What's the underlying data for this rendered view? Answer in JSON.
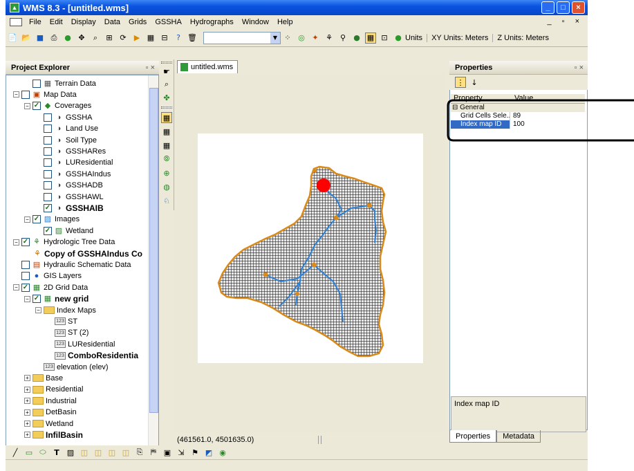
{
  "window": {
    "title": "WMS 8.3 - [untitled.wms]",
    "app_icon": "wms-app-icon",
    "controls": [
      "minimize",
      "maximize",
      "close"
    ]
  },
  "menu": {
    "items": [
      "File",
      "Edit",
      "Display",
      "Data",
      "Grids",
      "GSSHA",
      "Hydrographs",
      "Window",
      "Help"
    ],
    "mdi_controls": "_ &#x1F5D7; ×"
  },
  "toolbar": {
    "units_button": "Units",
    "xy_units": "XY Units: Meters",
    "z_units": "Z Units: Meters"
  },
  "explorer": {
    "title": "Project Explorer",
    "close": "×",
    "items": [
      {
        "label": "Terrain Data",
        "level": 1,
        "bold": false
      },
      {
        "label": "Map Data",
        "level": 0,
        "bold": false
      },
      {
        "label": "Coverages",
        "level": 1,
        "bold": false
      },
      {
        "label": "GSSHA",
        "level": 2,
        "bold": false
      },
      {
        "label": "Land Use",
        "level": 2,
        "bold": false
      },
      {
        "label": "Soil Type",
        "level": 2,
        "bold": false
      },
      {
        "label": "GSSHARes",
        "level": 2,
        "bold": false
      },
      {
        "label": "LUResidential",
        "level": 2,
        "bold": false
      },
      {
        "label": "GSSHAIndus",
        "level": 2,
        "bold": false
      },
      {
        "label": "GSSHADB",
        "level": 2,
        "bold": false
      },
      {
        "label": "GSSHAWL",
        "level": 2,
        "bold": false
      },
      {
        "label": "GSSHAIB",
        "level": 2,
        "bold": true
      },
      {
        "label": "Images",
        "level": 1,
        "bold": false
      },
      {
        "label": "Wetland",
        "level": 2,
        "bold": false
      },
      {
        "label": "Hydrologic Tree Data",
        "level": 0,
        "bold": false
      },
      {
        "label": "Copy of GSSHAIndus Co",
        "level": 1,
        "bold": true
      },
      {
        "label": "Hydraulic Schematic Data",
        "level": 0,
        "bold": false
      },
      {
        "label": "GIS Layers",
        "level": 0,
        "bold": false
      },
      {
        "label": "2D Grid Data",
        "level": 0,
        "bold": false
      },
      {
        "label": "new grid",
        "level": 1,
        "bold": true
      },
      {
        "label": "Index Maps",
        "level": 2,
        "bold": false
      },
      {
        "label": "ST",
        "level": 3,
        "bold": false
      },
      {
        "label": "ST (2)",
        "level": 3,
        "bold": false
      },
      {
        "label": "LUResidential",
        "level": 3,
        "bold": false
      },
      {
        "label": "ComboResidentia",
        "level": 3,
        "bold": true
      },
      {
        "label": "elevation (elev)",
        "level": 2,
        "bold": false
      },
      {
        "label": "Base",
        "level": 1,
        "bold": false
      },
      {
        "label": "Residential",
        "level": 1,
        "bold": false
      },
      {
        "label": "Industrial",
        "level": 1,
        "bold": false
      },
      {
        "label": "DetBasin",
        "level": 1,
        "bold": false
      },
      {
        "label": "Wetland",
        "level": 1,
        "bold": false
      },
      {
        "label": "InfilBasin",
        "level": 1,
        "bold": true
      }
    ]
  },
  "document": {
    "tab_label": "untitled.wms",
    "coordinates": "(461561.0, 4501635.0)"
  },
  "properties": {
    "title": "Properties",
    "close": "×",
    "col_property": "Property",
    "col_value": "Value",
    "group": "General",
    "rows": [
      {
        "key": "Grid Cells Sele...",
        "value": "89",
        "selected": false
      },
      {
        "key": "Index map ID",
        "value": "100",
        "selected": true
      }
    ],
    "description": "Index map ID",
    "tabs": [
      "Properties",
      "Metadata"
    ]
  },
  "colors": {
    "title_bar": "#0a54e0",
    "watershed_fill": "#3a3a3a",
    "watershed_outline": "#d98a18",
    "stream": "#2e7fd6",
    "outlet": "#ff0000",
    "selection": "#316ac5"
  }
}
